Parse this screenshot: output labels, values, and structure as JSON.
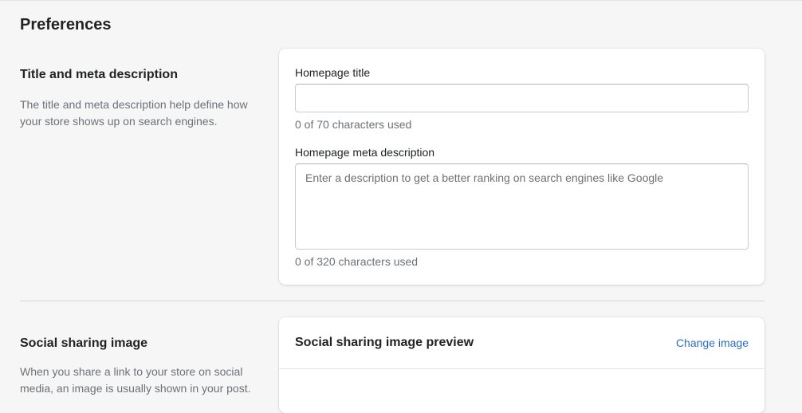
{
  "page": {
    "title": "Preferences"
  },
  "title_meta_section": {
    "heading": "Title and meta description",
    "description": "The title and meta description help define how your store shows up on search engines.",
    "homepage_title": {
      "label": "Homepage title",
      "value": "",
      "placeholder": "",
      "counter": "0 of 70 characters used"
    },
    "meta_description": {
      "label": "Homepage meta description",
      "value": "",
      "placeholder": "Enter a description to get a better ranking on search engines like Google",
      "counter": "0 of 320 characters used"
    }
  },
  "social_section": {
    "heading": "Social sharing image",
    "description": "When you share a link to your store on social media, an image is usually shown in your post.",
    "card_title": "Social sharing image preview",
    "change_image_label": "Change image"
  }
}
